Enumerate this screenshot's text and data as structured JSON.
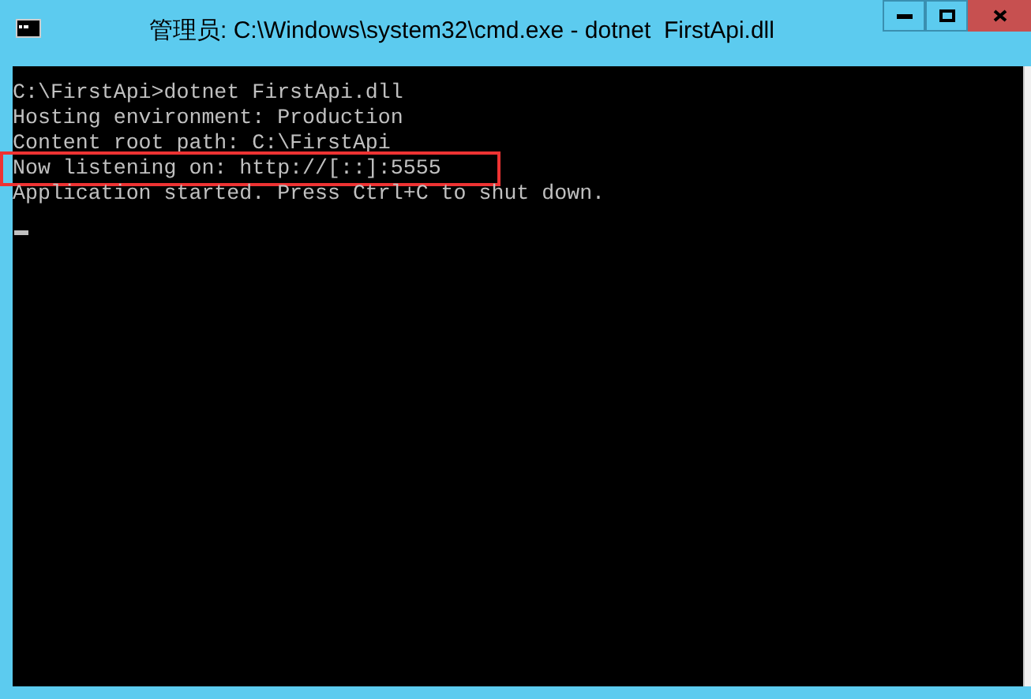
{
  "window": {
    "title": "管理员: C:\\Windows\\system32\\cmd.exe - dotnet  FirstApi.dll"
  },
  "console": {
    "lines": [
      {
        "text": "C:\\FirstApi>dotnet FirstApi.dll",
        "highlighted": false
      },
      {
        "text": "Hosting environment: Production",
        "highlighted": false
      },
      {
        "text": "Content root path: C:\\FirstApi",
        "highlighted": false
      },
      {
        "text": "Now listening on: http://[::]:5555",
        "highlighted": true
      },
      {
        "text": "Application started. Press Ctrl+C to shut down.",
        "highlighted": false
      }
    ]
  }
}
